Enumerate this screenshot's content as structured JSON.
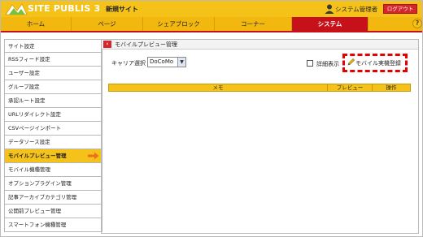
{
  "header": {
    "logo_text": "SITE PUBLIS 3",
    "site_name": "新規サイト",
    "user_name": "システム管理者",
    "logout_label": "ログアウト",
    "help_label": "?"
  },
  "nav": {
    "tabs": [
      {
        "label": "ホーム"
      },
      {
        "label": "ページ"
      },
      {
        "label": "シェアブロック"
      },
      {
        "label": "コーナー"
      },
      {
        "label": "システム"
      }
    ],
    "active_tab": "システム"
  },
  "sidebar": {
    "items": [
      {
        "label": "サイト設定"
      },
      {
        "label": "RSSフィード設定"
      },
      {
        "label": "ユーザー設定"
      },
      {
        "label": "グループ設定"
      },
      {
        "label": "承認ルート設定"
      },
      {
        "label": "URLリダイレクト設定"
      },
      {
        "label": "CSVページインポート"
      },
      {
        "label": "データソース設定"
      },
      {
        "label": "モバイルプレビュー管理"
      },
      {
        "label": "モバイル機種管理"
      },
      {
        "label": "オプションプラグイン管理"
      },
      {
        "label": "記事アーカイブカテゴリ管理"
      },
      {
        "label": "公開前プレビュー管理"
      },
      {
        "label": "スマートフォン機種管理"
      }
    ],
    "active_item": "モバイルプレビュー管理"
  },
  "main": {
    "title": "モバイルプレビュー管理",
    "carrier_label": "キャリア選択",
    "carrier_selected": "DoCoMo",
    "detail_label": "詳細表示",
    "register_label": "モバイル実機登録",
    "table_headers": [
      "メモ",
      "プレビュー",
      "操作"
    ]
  },
  "colors": {
    "header_yellow": "#f5c21a",
    "active_red": "#c7111a",
    "highlight_red": "#e60000"
  }
}
